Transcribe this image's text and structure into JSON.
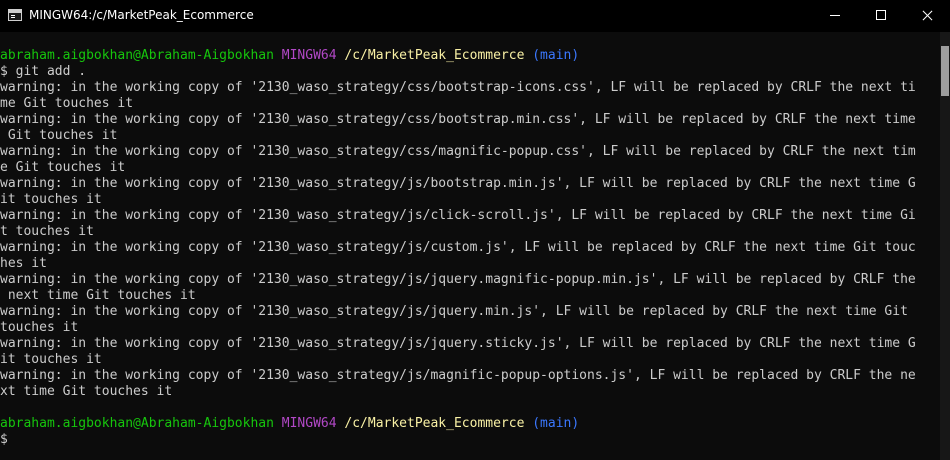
{
  "window": {
    "title": "MINGW64:/c/MarketPeak_Ecommerce",
    "icon": "terminal-app-icon"
  },
  "colors": {
    "background": "#0c0c0c",
    "text": "#cccccc",
    "user_host": "#16c60c",
    "shell_name": "#b148c6",
    "path": "#f9f1a5",
    "branch": "#3b78ff"
  },
  "prompt1": {
    "user_host": "abraham.aigbokhan@Abraham-Aigbokhan",
    "shell": "MINGW64",
    "path": "/c/MarketPeak_Ecommerce",
    "branch": "(main)"
  },
  "command1": "$ git add .",
  "output": [
    "warning: in the working copy of '2130_waso_strategy/css/bootstrap-icons.css', LF will be replaced by CRLF the next ti",
    "me Git touches it",
    "warning: in the working copy of '2130_waso_strategy/css/bootstrap.min.css', LF will be replaced by CRLF the next time",
    " Git touches it",
    "warning: in the working copy of '2130_waso_strategy/css/magnific-popup.css', LF will be replaced by CRLF the next tim",
    "e Git touches it",
    "warning: in the working copy of '2130_waso_strategy/js/bootstrap.min.js', LF will be replaced by CRLF the next time G",
    "it touches it",
    "warning: in the working copy of '2130_waso_strategy/js/click-scroll.js', LF will be replaced by CRLF the next time Gi",
    "t touches it",
    "warning: in the working copy of '2130_waso_strategy/js/custom.js', LF will be replaced by CRLF the next time Git touc",
    "hes it",
    "warning: in the working copy of '2130_waso_strategy/js/jquery.magnific-popup.min.js', LF will be replaced by CRLF the",
    " next time Git touches it",
    "warning: in the working copy of '2130_waso_strategy/js/jquery.min.js', LF will be replaced by CRLF the next time Git",
    "touches it",
    "warning: in the working copy of '2130_waso_strategy/js/jquery.sticky.js', LF will be replaced by CRLF the next time G",
    "it touches it",
    "warning: in the working copy of '2130_waso_strategy/js/magnific-popup-options.js', LF will be replaced by CRLF the ne",
    "xt time Git touches it"
  ],
  "prompt2": {
    "user_host": "abraham.aigbokhan@Abraham-Aigbokhan",
    "shell": "MINGW64",
    "path": "/c/MarketPeak_Ecommerce",
    "branch": "(main)"
  },
  "command2": "$"
}
